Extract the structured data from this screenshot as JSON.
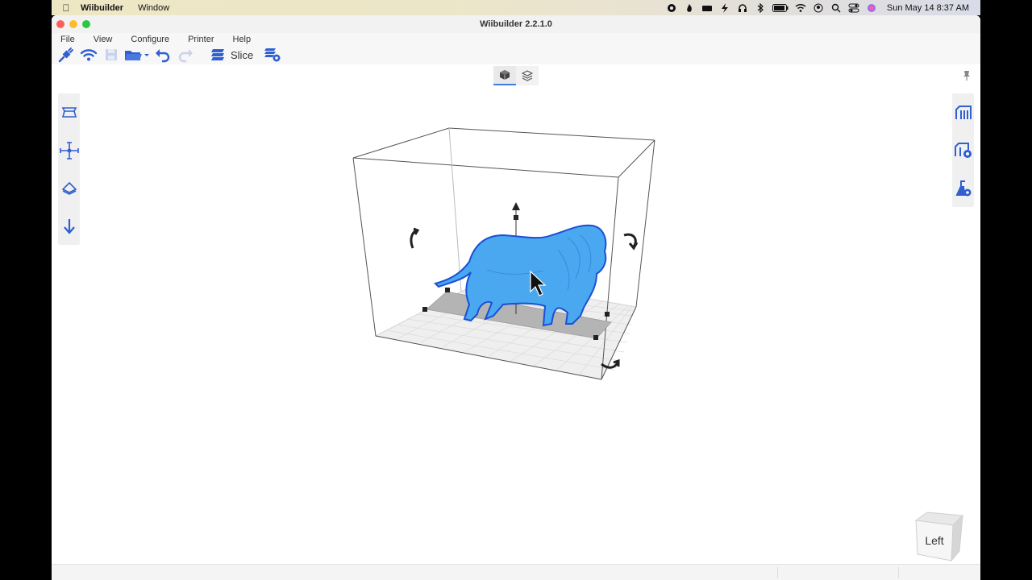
{
  "menubar": {
    "app_name": "Wiibuilder",
    "items": [
      "Window"
    ],
    "clock": "Sun May 14  8:37 AM"
  },
  "window": {
    "title": "Wiibuilder 2.2.1.0"
  },
  "app_menu": [
    "File",
    "View",
    "Configure",
    "Printer",
    "Help"
  ],
  "toolbar": {
    "slice_label": "Slice"
  },
  "viewcube": {
    "face_label": "Left"
  },
  "colors": {
    "accent": "#2f5fd0",
    "model": "#4aa8f0",
    "model_outline": "#1a4fd6"
  }
}
